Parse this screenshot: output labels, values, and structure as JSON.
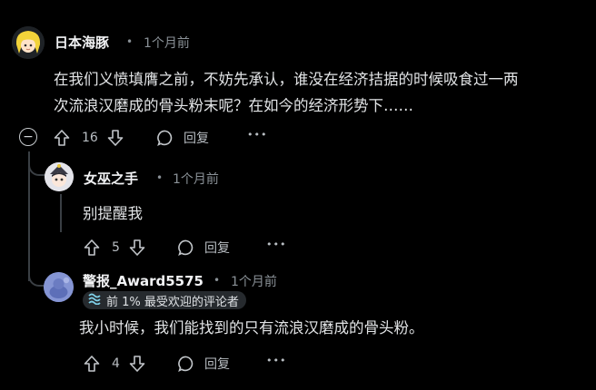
{
  "comments": [
    {
      "username": "日本海豚",
      "separator": "•",
      "time": "1个月前",
      "text_line1": "在我们义愤填膺之前，不妨先承认，谁没在经济拮据的时候吸食过一两",
      "text_line2": "次流浪汉磨成的骨头粉末呢？在如今的经济形势下……",
      "votes": "16",
      "reply_label": "回复",
      "more_label": "•••",
      "collapse_symbol": "−"
    },
    {
      "username": "女巫之手",
      "separator": "•",
      "time": "1个月前",
      "text": "别提醒我",
      "votes": "5",
      "reply_label": "回复",
      "more_label": "•••"
    },
    {
      "username": "警报_Award5575",
      "separator": "•",
      "time": "1个月前",
      "badge": "前 1% 最受欢迎的评论者",
      "text": "我小时候，我们能找到的只有流浪汉磨成的骨头粉。",
      "votes": "4",
      "reply_label": "回复",
      "more_label": "•••"
    }
  ],
  "colors": {
    "background": "#000000",
    "text": "#e2e4e6",
    "muted": "#8a9197",
    "thread_line": "#3a3f44",
    "badge_bg": "#262a2e"
  },
  "icons": [
    "avatar-yellow-hair",
    "avatar-witch",
    "avatar-alert",
    "upvote-icon",
    "downvote-icon",
    "reply-bubble-icon",
    "more-dots-icon",
    "collapse-icon",
    "badge-wave-icon"
  ]
}
